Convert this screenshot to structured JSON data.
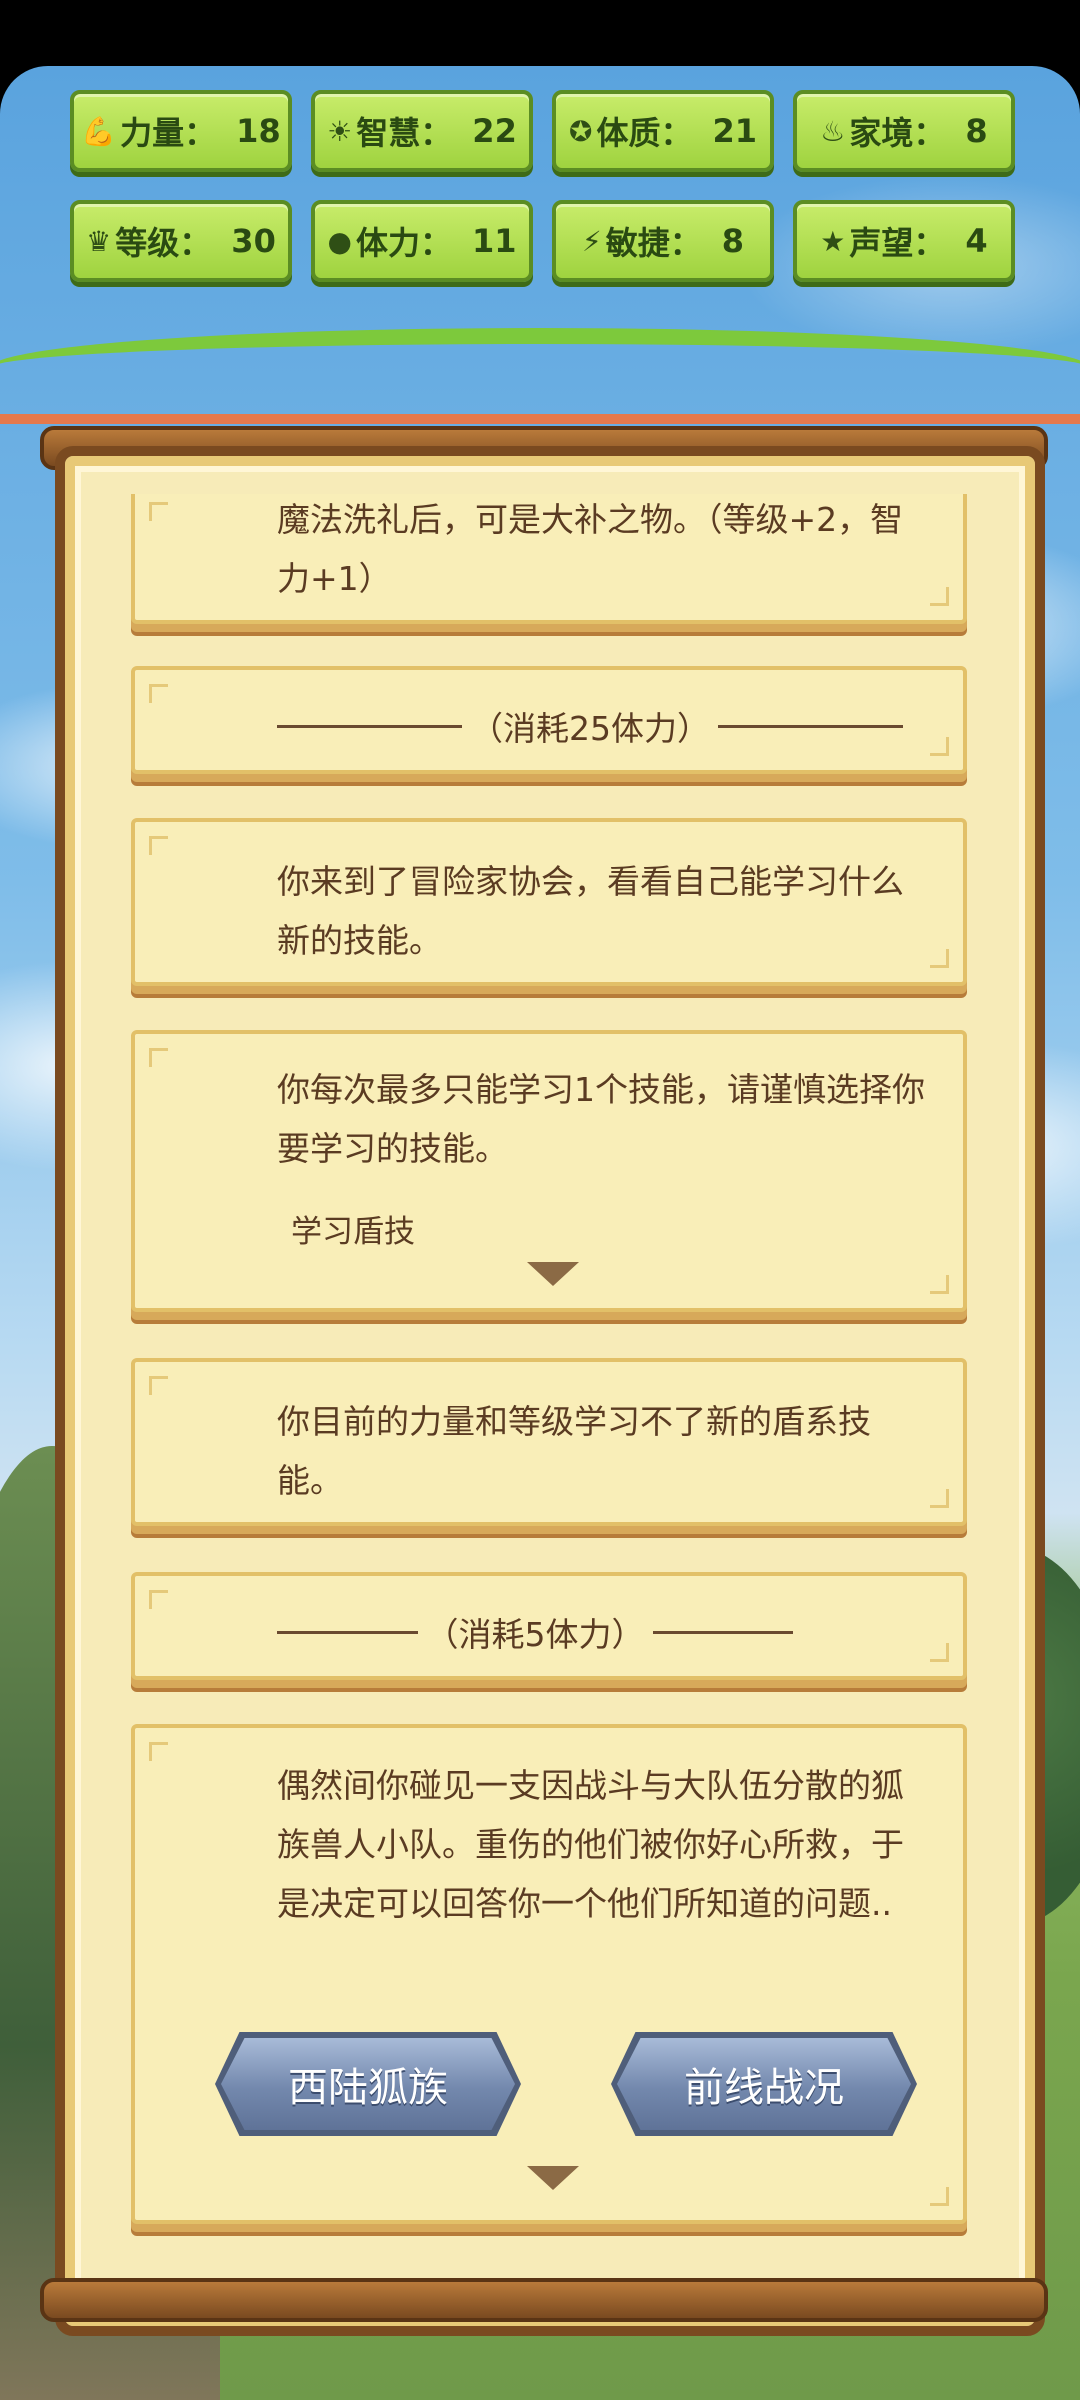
{
  "stats": [
    {
      "icon": "strength-icon",
      "glyph": "💪",
      "label": "力量：",
      "value": "18"
    },
    {
      "icon": "wisdom-icon",
      "glyph": "☀",
      "label": "智慧：",
      "value": "22"
    },
    {
      "icon": "constitution-icon",
      "glyph": "✪",
      "label": "体质：",
      "value": "21"
    },
    {
      "icon": "family-icon",
      "glyph": "♨",
      "label": "家境：",
      "value": "8"
    },
    {
      "icon": "crown-icon",
      "glyph": "♛",
      "label": "等级：",
      "value": "30"
    },
    {
      "icon": "heart-icon",
      "glyph": "●",
      "label": "体力：",
      "value": "11"
    },
    {
      "icon": "lightning-icon",
      "glyph": "⚡",
      "label": "敏捷：",
      "value": "8"
    },
    {
      "icon": "star-icon",
      "glyph": "★",
      "label": "声望：",
      "value": "4"
    }
  ],
  "log": {
    "entry1": "魔法洗礼后，可是大补之物。（等级+2，智力+1）",
    "sep1": "（消耗25体力）",
    "entry2": "你来到了冒险家协会，看看自己能学习什么新的技能。",
    "entry3": "你每次最多只能学习1个技能，请谨慎选择你要学习的技能。",
    "entry3_choice": "学习盾技",
    "entry4": "你目前的力量和等级学习不了新的盾系技能。",
    "sep2": "（消耗5体力）",
    "entry5": "偶然间你碰见一支因战斗与大队伍分散的狐族兽人小队。重伤的他们被你好心所救，于是决定可以回答你一个他们所知道的问题..",
    "option_a": "西陆狐族",
    "option_b": "前线战况"
  }
}
